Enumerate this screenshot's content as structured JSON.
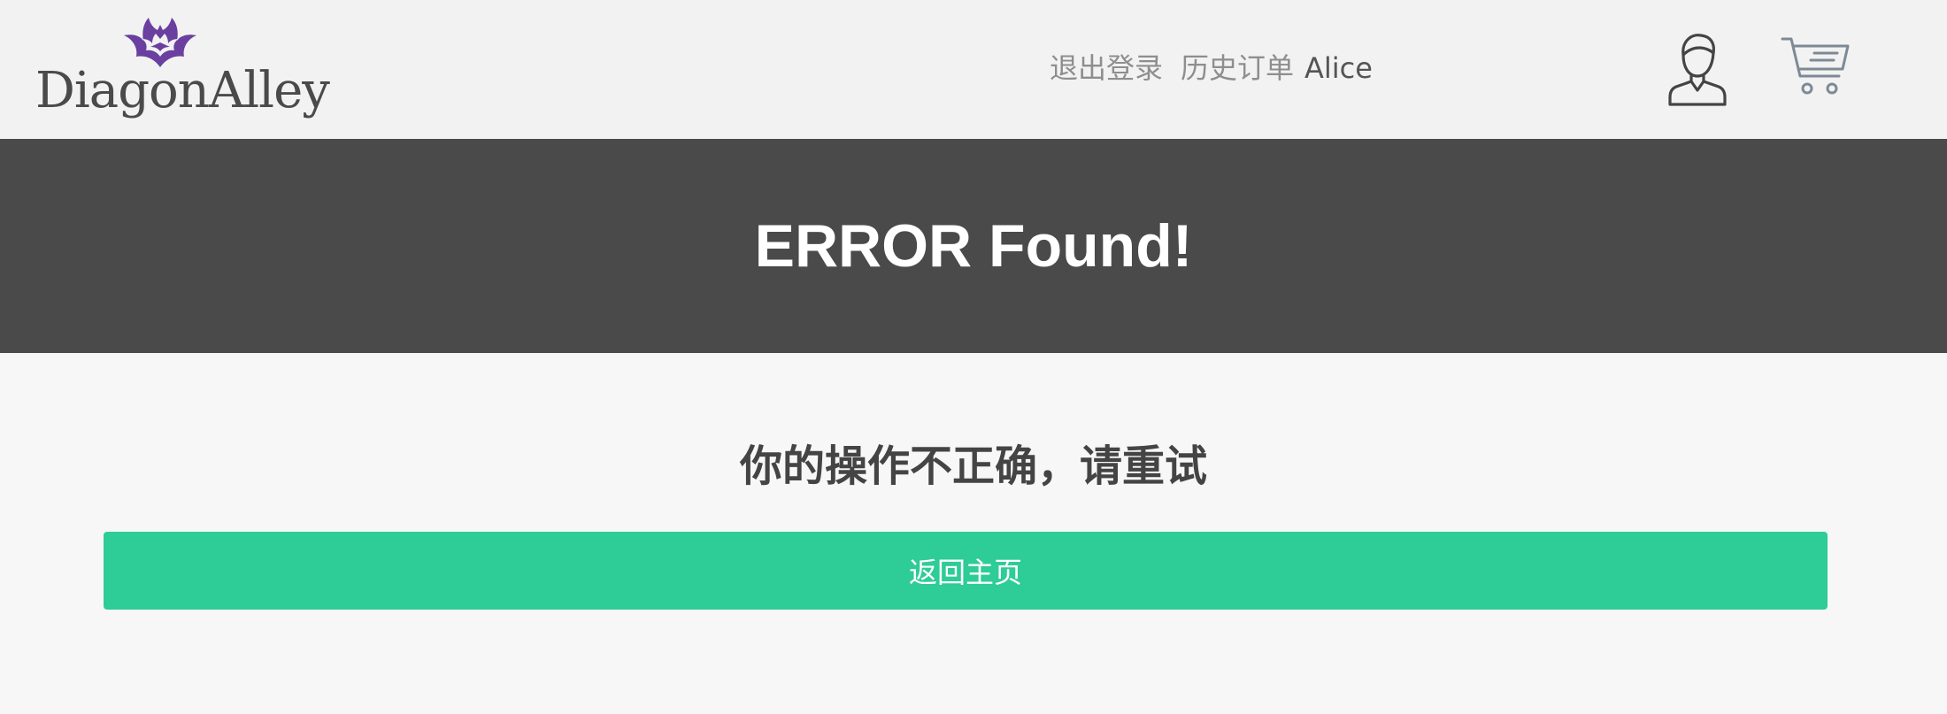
{
  "brand": {
    "name": "DiagonAlley",
    "logo_icon": "bat-logo-icon",
    "accent": "#6a3fa0"
  },
  "nav": {
    "logout": "退出登录",
    "orders": "历史订单",
    "user": "Alice",
    "user_icon": "user-avatar-icon",
    "cart_icon": "shopping-cart-icon"
  },
  "banner": {
    "title": "ERROR Found!",
    "background": "#4a4a4a"
  },
  "main": {
    "message": "你的操作不正确，请重试",
    "home_button": "返回主页",
    "button_color": "#2ecc96"
  }
}
